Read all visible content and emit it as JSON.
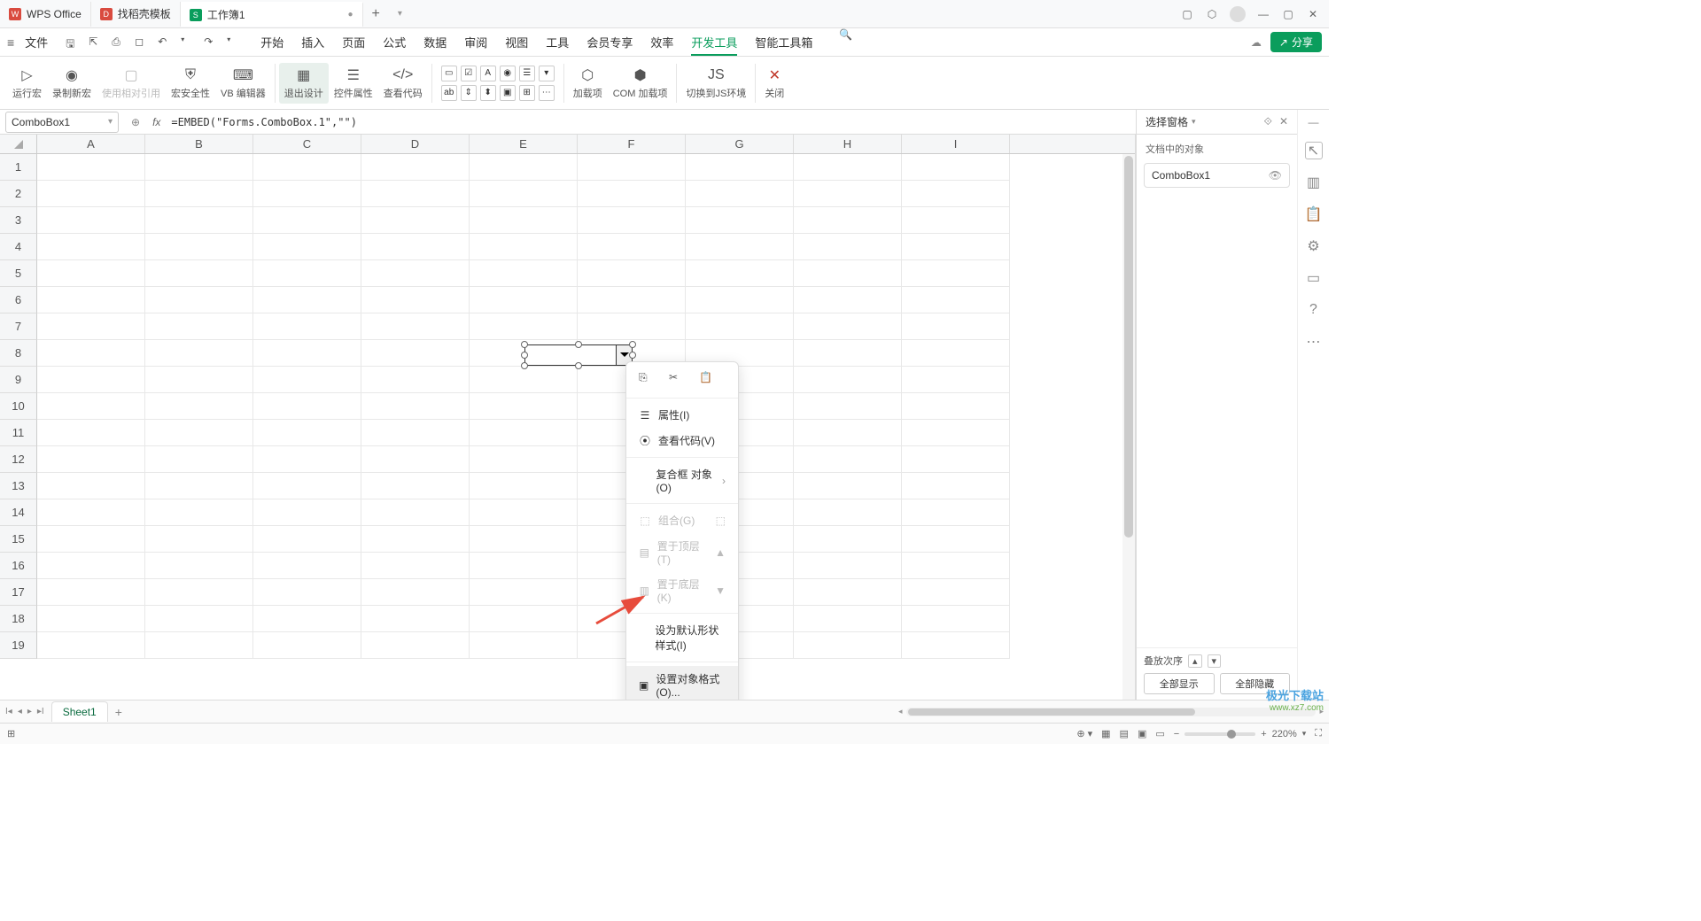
{
  "titlebar": {
    "tabs": [
      {
        "label": "WPS Office",
        "icon_color": "#d94b3f"
      },
      {
        "label": "找稻壳模板",
        "icon_color": "#d94b3f"
      },
      {
        "label": "工作簿1",
        "icon_color": "#0a9d5c",
        "active": true
      }
    ]
  },
  "menubar": {
    "file": "文件",
    "tabs": [
      "开始",
      "插入",
      "页面",
      "公式",
      "数据",
      "审阅",
      "视图",
      "工具",
      "会员专享",
      "效率",
      "开发工具",
      "智能工具箱"
    ],
    "active_tab": "开发工具",
    "share": "分享"
  },
  "ribbon": {
    "run_macro": "运行宏",
    "record_macro": "录制新宏",
    "relative_ref": "使用相对引用",
    "macro_security": "宏安全性",
    "vb_editor": "VB 编辑器",
    "exit_design": "退出设计",
    "control_props": "控件属性",
    "view_code": "查看代码",
    "addin": "加载项",
    "com_addin": "COM 加载项",
    "switch_js": "切换到JS环境",
    "close": "关闭"
  },
  "formulabar": {
    "namebox": "ComboBox1",
    "formula": "=EMBED(\"Forms.ComboBox.1\",\"\")"
  },
  "grid": {
    "columns": [
      "A",
      "B",
      "C",
      "D",
      "E",
      "F",
      "G",
      "H",
      "I"
    ],
    "rows": [
      "1",
      "2",
      "3",
      "4",
      "5",
      "6",
      "7",
      "8",
      "9",
      "10",
      "11",
      "12",
      "13",
      "14",
      "15",
      "16",
      "17",
      "18",
      "19"
    ]
  },
  "contextmenu": {
    "copy": "",
    "cut": "",
    "paste": "",
    "properties": "属性(I)",
    "view_code": "查看代码(V)",
    "compound_object": "复合框 对象(O)",
    "group": "组合(G)",
    "bring_front": "置于顶层(T)",
    "send_back": "置于底层(K)",
    "set_default_style": "设为默认形状样式(I)",
    "format_object": "设置对象格式(O)..."
  },
  "sidepanel": {
    "title": "选择窗格",
    "subtitle": "文档中的对象",
    "items": [
      "ComboBox1"
    ],
    "stack_order_label": "叠放次序",
    "show_all": "全部显示",
    "hide_all": "全部隐藏"
  },
  "sheettabs": {
    "active": "Sheet1"
  },
  "statusbar": {
    "zoom": "220%"
  },
  "watermark": {
    "line1": "极光下载站",
    "line2": "www.xz7.com"
  }
}
